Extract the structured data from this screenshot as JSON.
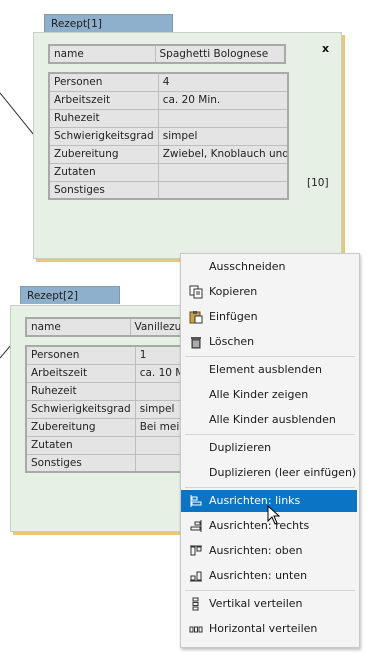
{
  "card1": {
    "tab": "Rezept[1]",
    "close": "x",
    "count": "[10]",
    "name_label": "name",
    "name_value": "Spaghetti Bolognese",
    "rows": [
      {
        "label": "Personen",
        "value": "4"
      },
      {
        "label": "Arbeitszeit",
        "value": "ca. 20 Min."
      },
      {
        "label": "Ruhezeit",
        "value": ""
      },
      {
        "label": "Schwierigkeitsgrad",
        "value": "simpel"
      },
      {
        "label": "Zubereitung",
        "value": "Zwiebel, Knoblauch und…"
      },
      {
        "label": "Zutaten",
        "value": ""
      },
      {
        "label": "Sonstiges",
        "value": ""
      }
    ]
  },
  "card2": {
    "tab": "Rezept[2]",
    "name_label": "name",
    "name_value": "Vanillezuc",
    "rows": [
      {
        "label": "Personen",
        "value": "1"
      },
      {
        "label": "Arbeitszeit",
        "value": "ca. 10 Min"
      },
      {
        "label": "Ruhezeit",
        "value": ""
      },
      {
        "label": "Schwierigkeitsgrad",
        "value": "simpel"
      },
      {
        "label": "Zubereitung",
        "value": "Bei meine"
      },
      {
        "label": "Zutaten",
        "value": ""
      },
      {
        "label": "Sonstiges",
        "value": ""
      }
    ]
  },
  "menu": {
    "items": [
      {
        "label": "Ausschneiden",
        "icon": "none"
      },
      {
        "label": "Kopieren",
        "icon": "copy-icon"
      },
      {
        "label": "Einfügen",
        "icon": "paste-icon"
      },
      {
        "label": "Löschen",
        "icon": "trash-icon"
      },
      {
        "label": "Element ausblenden",
        "icon": "none"
      },
      {
        "label": "Alle Kinder zeigen",
        "icon": "none"
      },
      {
        "label": "Alle Kinder ausblenden",
        "icon": "none"
      },
      {
        "label": "Duplizieren",
        "icon": "none"
      },
      {
        "label": "Duplizieren (leer einfügen)",
        "icon": "none"
      },
      {
        "label": "Ausrichten: links",
        "icon": "align-left-icon"
      },
      {
        "label": "Ausrichten: rechts",
        "icon": "align-right-icon"
      },
      {
        "label": "Ausrichten: oben",
        "icon": "align-top-icon"
      },
      {
        "label": "Ausrichten: unten",
        "icon": "align-bottom-icon"
      },
      {
        "label": "Vertikal verteilen",
        "icon": "distribute-vertical-icon"
      },
      {
        "label": "Horizontal verteilen",
        "icon": "distribute-horizontal-icon"
      }
    ],
    "active_item": "Ausrichten: links"
  },
  "colors": {
    "card_bg": "#e6f0e4",
    "tab_bg": "#8fb0cc",
    "card_shadow": "#e7c873",
    "menu_highlight": "#0b74c4"
  }
}
